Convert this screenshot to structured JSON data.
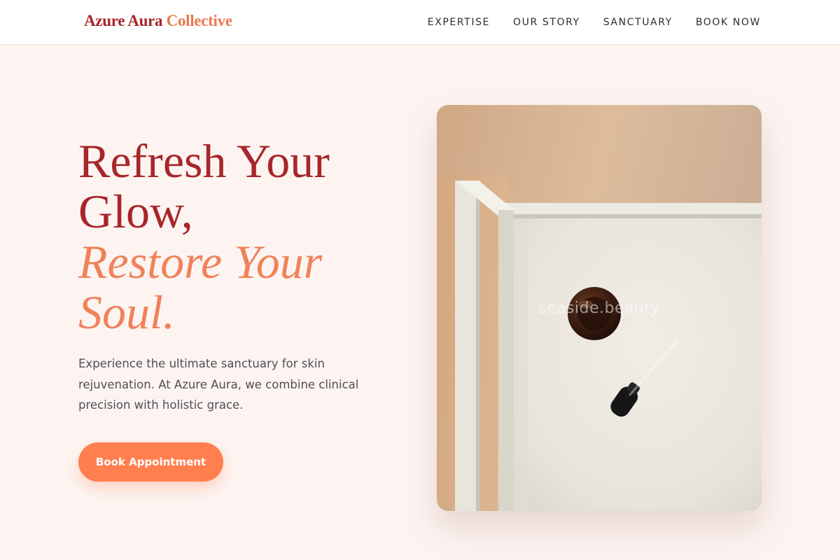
{
  "brand": {
    "primary": "Azure Aura",
    "accent": "Collective"
  },
  "nav": {
    "items": [
      {
        "label": "EXPERTISE"
      },
      {
        "label": "OUR STORY"
      },
      {
        "label": "SANCTUARY"
      },
      {
        "label": "BOOK NOW"
      }
    ]
  },
  "hero": {
    "headline_line1": "Refresh Your Glow,",
    "headline_line2": "Restore Your Soul.",
    "lead": "Experience the ultimate sanctuary for skin rejuvenation. At Azure Aura, we combine clinical precision with holistic grace.",
    "cta_label": "Book Appointment",
    "image_watermark": "seaside.beauty"
  },
  "colors": {
    "brand_red": "#a8262a",
    "accent_coral": "#f0825a",
    "cta": "#ff7f4f",
    "page_bg": "#fdf4f1"
  }
}
